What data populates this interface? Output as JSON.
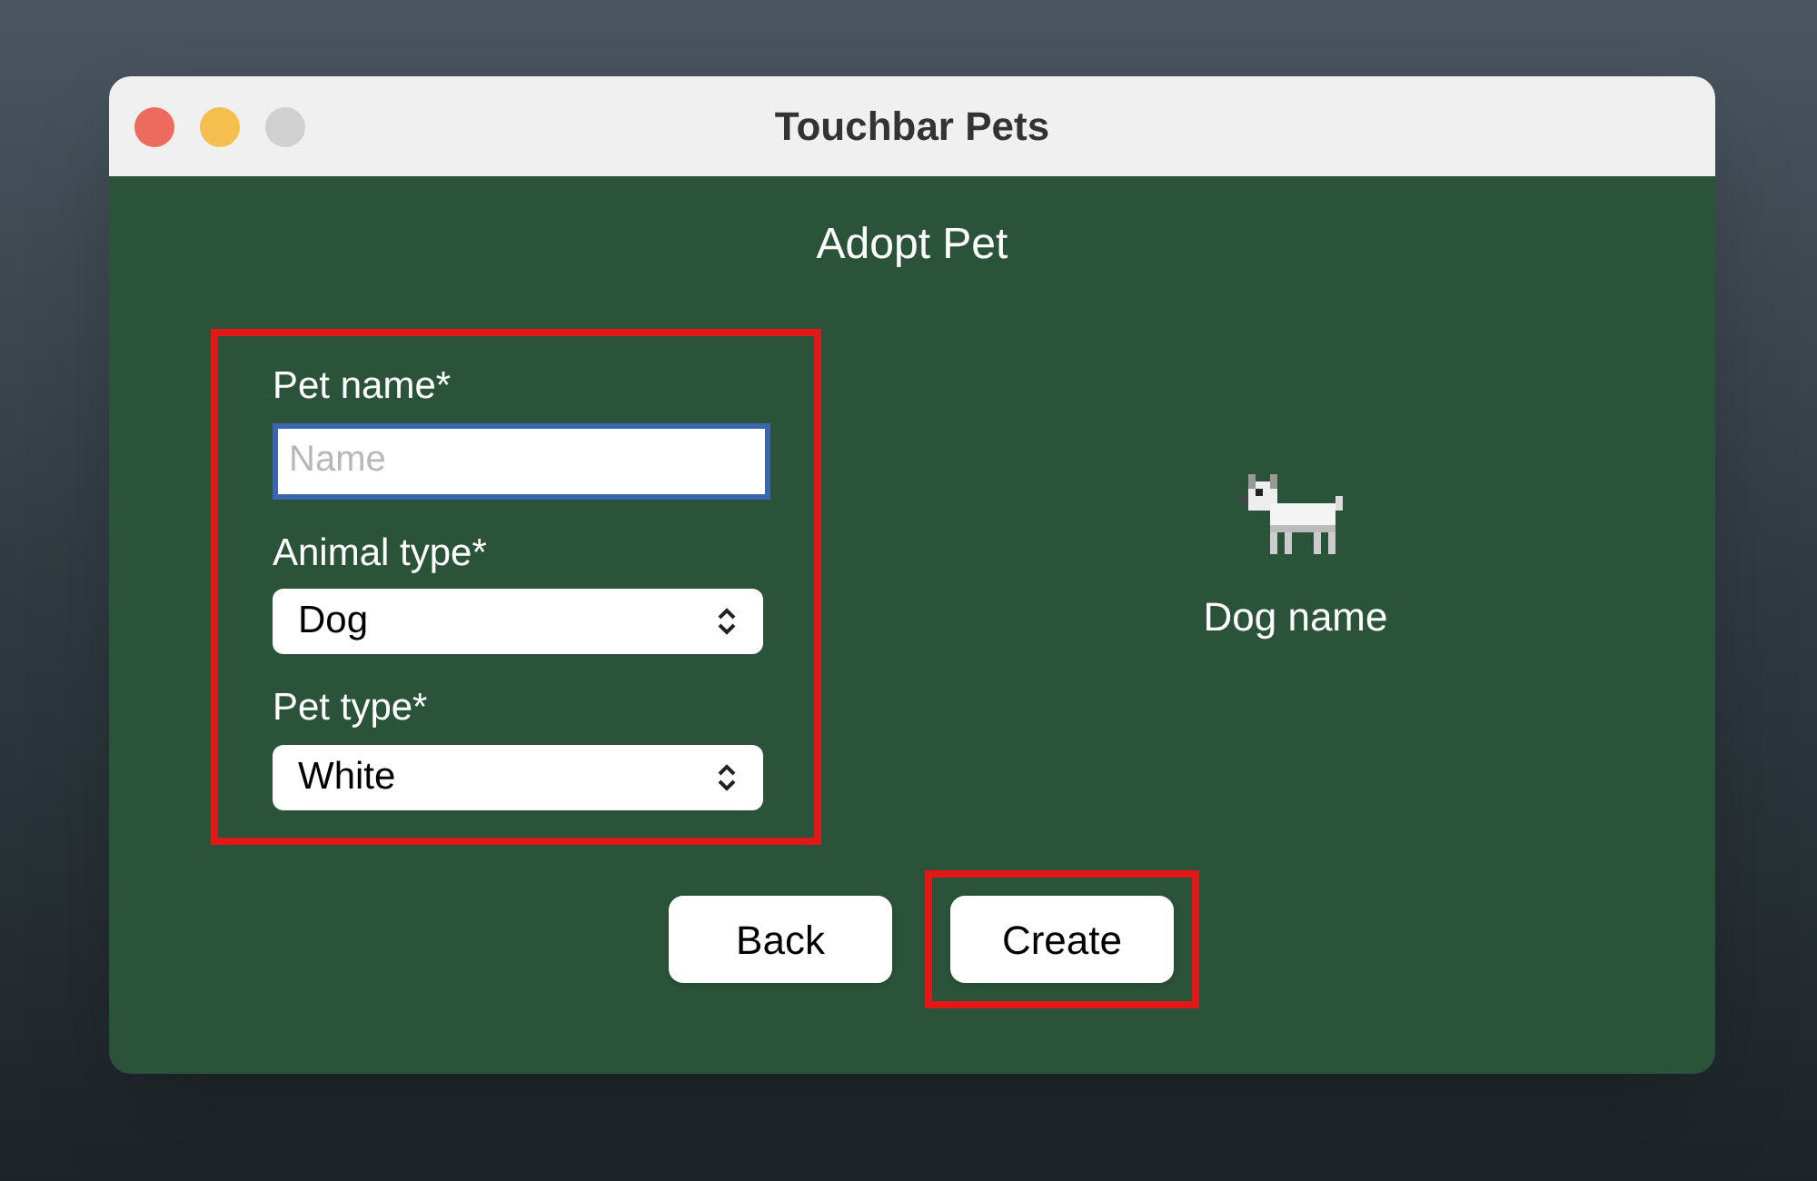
{
  "window": {
    "title": "Touchbar Pets"
  },
  "heading": "Adopt Pet",
  "form": {
    "highlighted": true,
    "fields": [
      {
        "kind": "text",
        "label": "Pet name*",
        "placeholder": "Name",
        "focused": true
      },
      {
        "kind": "select",
        "label": "Animal type*",
        "value": "Dog",
        "focused": false
      },
      {
        "kind": "select",
        "label": "Pet type*",
        "value": "White",
        "focused": false
      }
    ]
  },
  "preview": {
    "caption": "Dog name"
  },
  "buttons": [
    {
      "label": "Back",
      "highlighted": false
    },
    {
      "label": "Create",
      "highlighted": true
    }
  ]
}
